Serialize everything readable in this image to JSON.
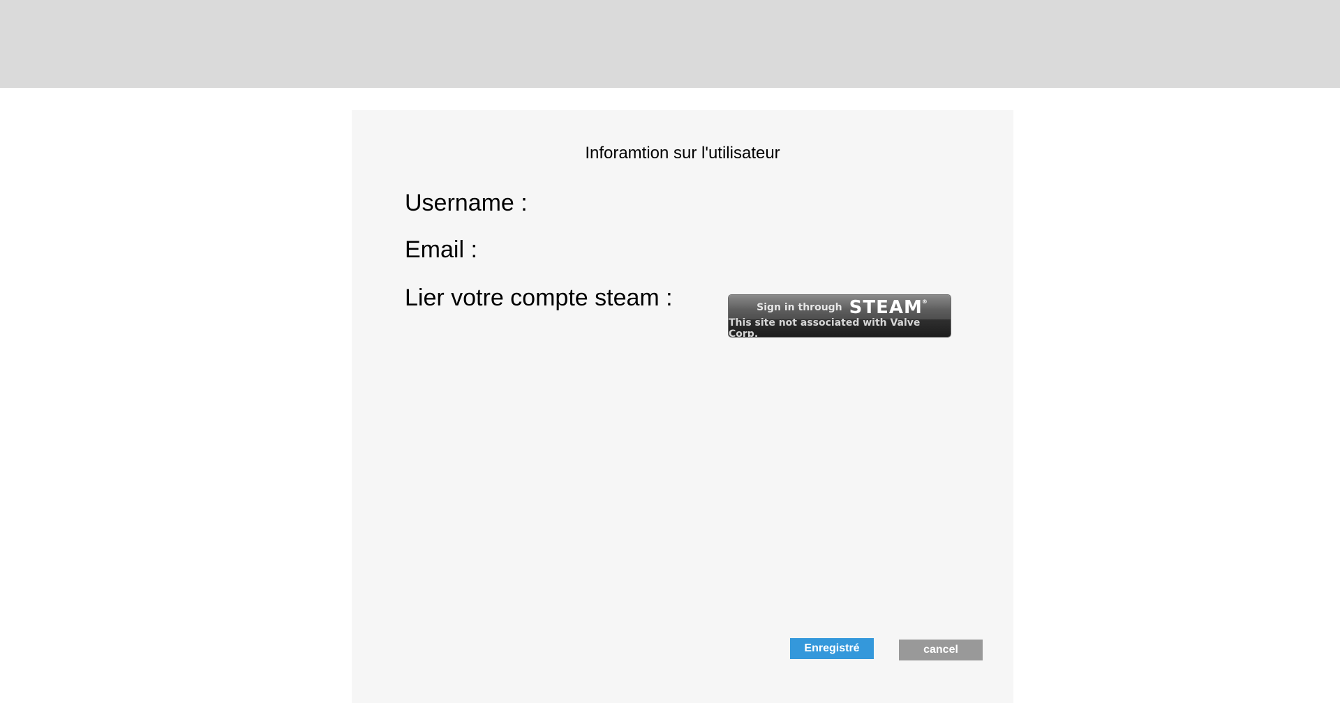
{
  "form": {
    "title": "Inforamtion sur l'utilisateur",
    "username_label": "Username :",
    "email_label": "Email :",
    "steam_label": "Lier votre compte steam :"
  },
  "steam_button": {
    "sign_in_text": "Sign in through",
    "brand": "STEAM",
    "trademark": "®",
    "disclaimer": "This site not associated with Valve Corp."
  },
  "actions": {
    "save_label": "Enregistré",
    "cancel_label": "cancel"
  },
  "colors": {
    "header_bar": "#dadada",
    "panel": "#f6f6f6",
    "save_button": "#3498db",
    "cancel_button": "#999999"
  }
}
